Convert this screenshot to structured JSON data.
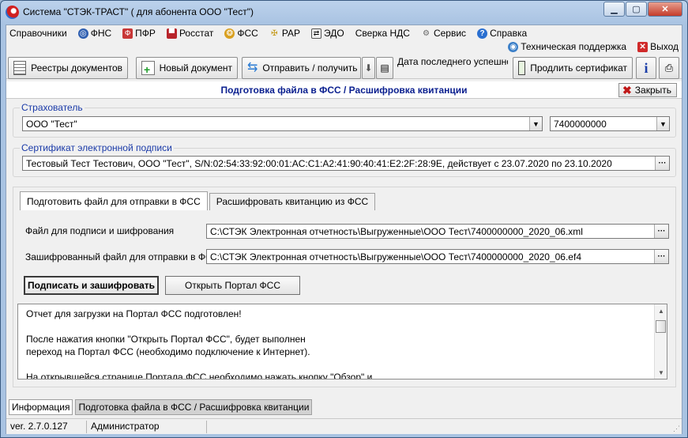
{
  "window": {
    "title": "Система \"СТЭК-ТРАСТ\" ( для абонента ООО \"Тест\")"
  },
  "menu": {
    "items": [
      {
        "label": "Справочники",
        "icon": "none"
      },
      {
        "label": "ФНС",
        "icon": "fns-icon"
      },
      {
        "label": "ПФР",
        "icon": "pfr-icon"
      },
      {
        "label": "Росстат",
        "icon": "rosstat-icon"
      },
      {
        "label": "ФСС",
        "icon": "fss-icon"
      },
      {
        "label": "РАР",
        "icon": "rar-icon"
      },
      {
        "label": "ЭДО",
        "icon": "edo-icon"
      },
      {
        "label": "Сверка НДС",
        "icon": "none"
      },
      {
        "label": "Сервис",
        "icon": "gear-icon"
      },
      {
        "label": "Справка",
        "icon": "help-icon"
      }
    ],
    "support_label": "Техническая поддержка",
    "exit_label": "Выход"
  },
  "toolbar": {
    "registries_label": "Реестры документов",
    "new_doc_label": "Новый документ",
    "send_receive_label": "Отправить / получить",
    "last_session_label": "Дата последнего успешного",
    "renew_cert_label": "Продлить сертификат",
    "info_glyph": "i"
  },
  "form": {
    "title": "Подготовка файла в ФСС / Расшифровка квитанции",
    "close_label": "Закрыть",
    "insurer": {
      "group_label": "Страхователь",
      "name": "ООО \"Тест\"",
      "inn": "7400000000"
    },
    "certificate": {
      "group_label": "Сертификат электронной подписи",
      "value": "Тестовый Тест Тестович, ООО \"Тест\", S/N:02:54:33:92:00:01:AC:C1:A2:41:90:40:41:E2:2F:28:9E, действует с 23.07.2020 по 23.10.2020"
    },
    "tabs": [
      {
        "label": "Подготовить файл для отправки в ФСС",
        "active": true
      },
      {
        "label": "Расшифровать квитанцию из ФСС",
        "active": false
      }
    ],
    "file_sign_label": "Файл для подписи и шифрования",
    "file_sign_value": "C:\\СТЭК Электронная отчетность\\Выгруженные\\ООО Тест\\7400000000_2020_06.xml",
    "file_enc_label": "Зашифрованный файл для отправки в ФСС",
    "file_enc_value": "C:\\СТЭК Электронная отчетность\\Выгруженные\\ООО Тест\\7400000000_2020_06.ef4",
    "sign_button": "Подписать и зашифровать",
    "portal_button": "Открыть Портал ФСС",
    "info_text": [
      "Отчет для загрузки на Портал ФСС подготовлен!",
      "После нажатия кнопки \"Открыть Портал ФСС\", будет выполнен\nпереход на Портал ФСС (необходимо подключение к Интернет).",
      "На открывшейся странице Портала ФСС необходимо нажать кнопку \"Обзор\" и"
    ]
  },
  "bottom_tabs": [
    {
      "label": "Информация",
      "selected": false
    },
    {
      "label": "Подготовка файла в ФСС / Расшифровка квитанции",
      "selected": true
    }
  ],
  "status": {
    "version": "ver. 2.7.0.127",
    "user": "Администратор"
  },
  "colors": {
    "form_title": "#0a1f8f",
    "group_label": "#1a3aa8",
    "close_x": "#c01818"
  }
}
